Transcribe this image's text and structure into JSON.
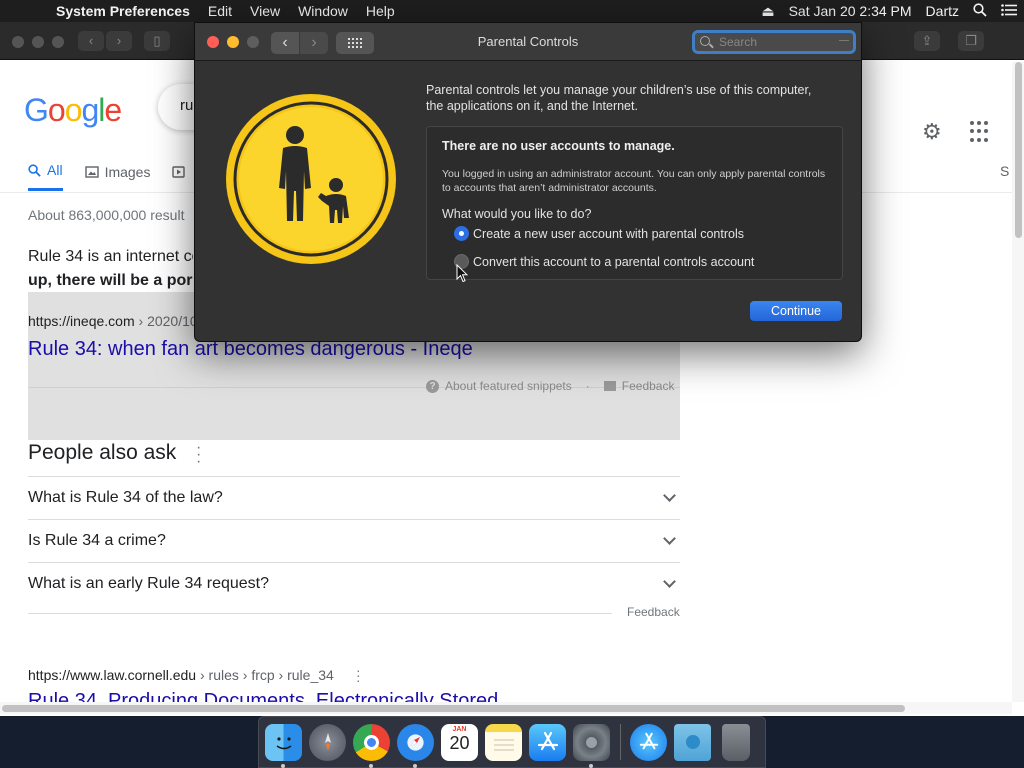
{
  "menubar": {
    "app_name": "System Preferences",
    "items": [
      "Edit",
      "View",
      "Window",
      "Help"
    ],
    "clock": "Sat Jan 20  2:34 PM",
    "user": "Dartz"
  },
  "google": {
    "logo": "Google",
    "query_fragment": "ru",
    "tabs": [
      {
        "label": "All",
        "active": true
      },
      {
        "label": "Images",
        "active": false
      }
    ],
    "tab_cut": "S",
    "result_stats": "About 863,000,000 result",
    "snippet_line1": "Rule 34 is an internet co",
    "snippet_line2": "up, there will be a por",
    "snippet_url_host": "https://ineqe.com",
    "snippet_url_path": " › 2020/10",
    "snippet_title": "Rule 34: when fan art becomes dangerous - Ineqe",
    "about_snippets": "About featured snippets",
    "separator": "·",
    "feedback": "Feedback",
    "paa_title": "People also ask",
    "paa_questions": [
      "What is Rule 34 of the law?",
      "Is Rule 34 a crime?",
      "What is an early Rule 34 request?"
    ],
    "paa_feedback": "Feedback",
    "result2_host": "https://www.law.cornell.edu",
    "result2_path": " › rules › frcp › rule_34",
    "result2_title": "Rule 34. Producing Documents, Electronically Stored"
  },
  "dialog": {
    "title": "Parental Controls",
    "search_placeholder": "Search",
    "intro": "Parental controls let you manage your children’s use of this computer, the applications on it, and the Internet.",
    "heading": "There are no user accounts to manage.",
    "body": "You logged in using an administrator account. You can only apply parental controls to accounts that aren’t administrator accounts.",
    "question": "What would you like to do?",
    "options": [
      {
        "label": "Create a new user account with parental controls",
        "selected": true
      },
      {
        "label": "Convert this account to a parental controls account",
        "selected": false
      }
    ],
    "continue_label": "Continue"
  },
  "dock": {
    "calendar_month": "JAN",
    "calendar_day": "20",
    "icons": [
      "finder-icon",
      "launchpad-icon",
      "chrome-icon",
      "safari-icon",
      "calendar-icon",
      "notes-icon",
      "app-store-icon",
      "system-preferences-icon",
      "app-store-icon",
      "downloads-folder-icon",
      "trash-icon"
    ]
  },
  "colors": {
    "accent": "#2d6fe0",
    "link": "#1a0dab",
    "google_blue": "#1a73e8",
    "parental_yellow": "#f5c518"
  }
}
